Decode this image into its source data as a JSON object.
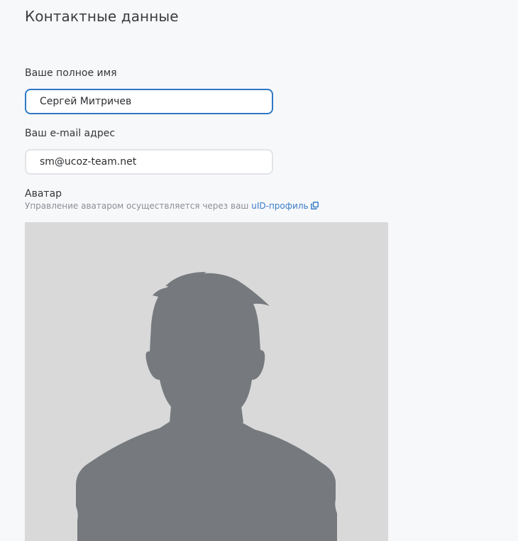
{
  "section": {
    "title": "Контактные данные"
  },
  "name_field": {
    "label": "Ваше полное имя",
    "value": "Сергей Митричев"
  },
  "email_field": {
    "label": "Ваш e-mail адрес",
    "value": "sm@ucoz-team.net"
  },
  "avatar": {
    "label": "Аватар",
    "hint_text": "Управление аватаром осуществляется через ваш",
    "link_text": "uID-профиль",
    "link_icon": "external-link-icon",
    "image": "default-user-silhouette"
  },
  "colors": {
    "background": "#f7f8fa",
    "focus_border": "#2f78c4",
    "link": "#3a7cc8",
    "avatar_bg": "#d9d9d9",
    "silhouette": "#767a7f"
  }
}
